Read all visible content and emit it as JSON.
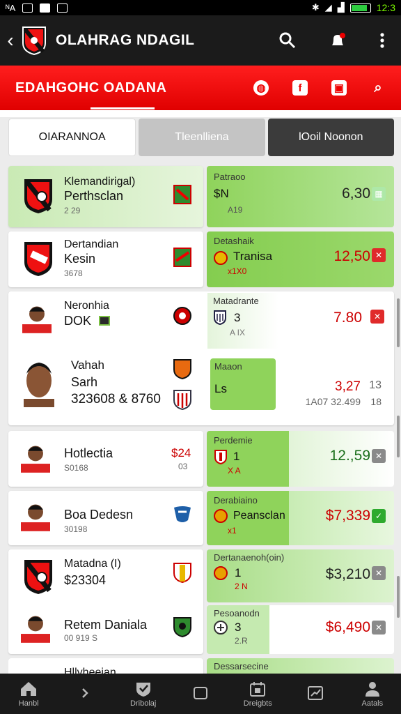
{
  "status": {
    "left_text": "ᴺA",
    "time": "12:3"
  },
  "appbar": {
    "title": "OLAHRAG NDAGIL"
  },
  "redbar": {
    "subtitle": "EDAHGOHC OADANA"
  },
  "tabs": [
    "OIARANNOA",
    "Tleenlliena",
    "lOoil Noonon"
  ],
  "rows": [
    {
      "line1": "Klemandirigal)",
      "line2": "Perthsclan",
      "meta": "2 29",
      "op_label": "Patraoo",
      "op_main": "$N",
      "op_sub": "A19",
      "odds": "6,30",
      "odds_color": "#222",
      "btn": "pale"
    },
    {
      "line1": "Dertandian",
      "line2": "Kesin",
      "meta": "3678",
      "op_label": "Detashaik",
      "op_main": "Tranisa",
      "op_sub": "x1X0",
      "odds": "12,50",
      "odds_color": "#c00",
      "btn": "red"
    },
    {
      "line1": "Neronhia",
      "line2": "DOK",
      "meta": "",
      "op_label": "Matadrante",
      "op_main": "3",
      "op_sub": "A IX",
      "odds": "7.80",
      "odds_color": "#c00",
      "btn": "red"
    },
    {
      "line1": "Vahah",
      "line2": "Sarh",
      "meta": "323608 & 8760",
      "op_label": "Maaon",
      "op_main": "Ls",
      "op_sub": "",
      "odds": "3,27",
      "odds_color": "#c00",
      "odds_extra": "13",
      "sub_odds": "1A07 32.499",
      "sub_extra": "18",
      "btn": ""
    },
    {
      "line1": "Hotlectia",
      "line2": "",
      "meta": "S0168",
      "side_odds": "$24",
      "side_sub": "03",
      "op_label": "Perdemie",
      "op_main": "1",
      "op_sub": "X A",
      "odds": "12.,59",
      "odds_color": "#1a6e1a",
      "btn": "grey"
    },
    {
      "line1": "Boa Dedesn",
      "line2": "",
      "meta": "30198",
      "op_label": "Derabiaino",
      "op_main": "Peansclan",
      "op_sub": "x1",
      "odds": "$7,339",
      "odds_color": "#c00",
      "btn": "green"
    },
    {
      "line1": "Matadna (I)",
      "line2": "$23304",
      "meta": "",
      "op_label": "Dertanaenoh(oin)",
      "op_main": "1",
      "op_sub": "2 N",
      "odds": "$3,210",
      "odds_color": "#222",
      "btn": "grey"
    },
    {
      "line1": "Retem Daniala",
      "line2": "",
      "meta": "00 919 S",
      "op_label": "Pesoanodn",
      "op_main": "3",
      "op_sub": "2.R",
      "odds": "$6,490",
      "odds_color": "#c00",
      "btn": "grey"
    },
    {
      "line1": "Hllyheeian",
      "line2": "",
      "meta": "",
      "op_label": "Dessarsecine",
      "op_main": "",
      "op_sub": "",
      "odds": "",
      "odds_color": "#222",
      "btn": ""
    }
  ],
  "bottom_nav": [
    "Hanbl",
    "",
    "Dribolaj",
    "",
    "Dreigbts",
    "",
    "Aatals"
  ]
}
